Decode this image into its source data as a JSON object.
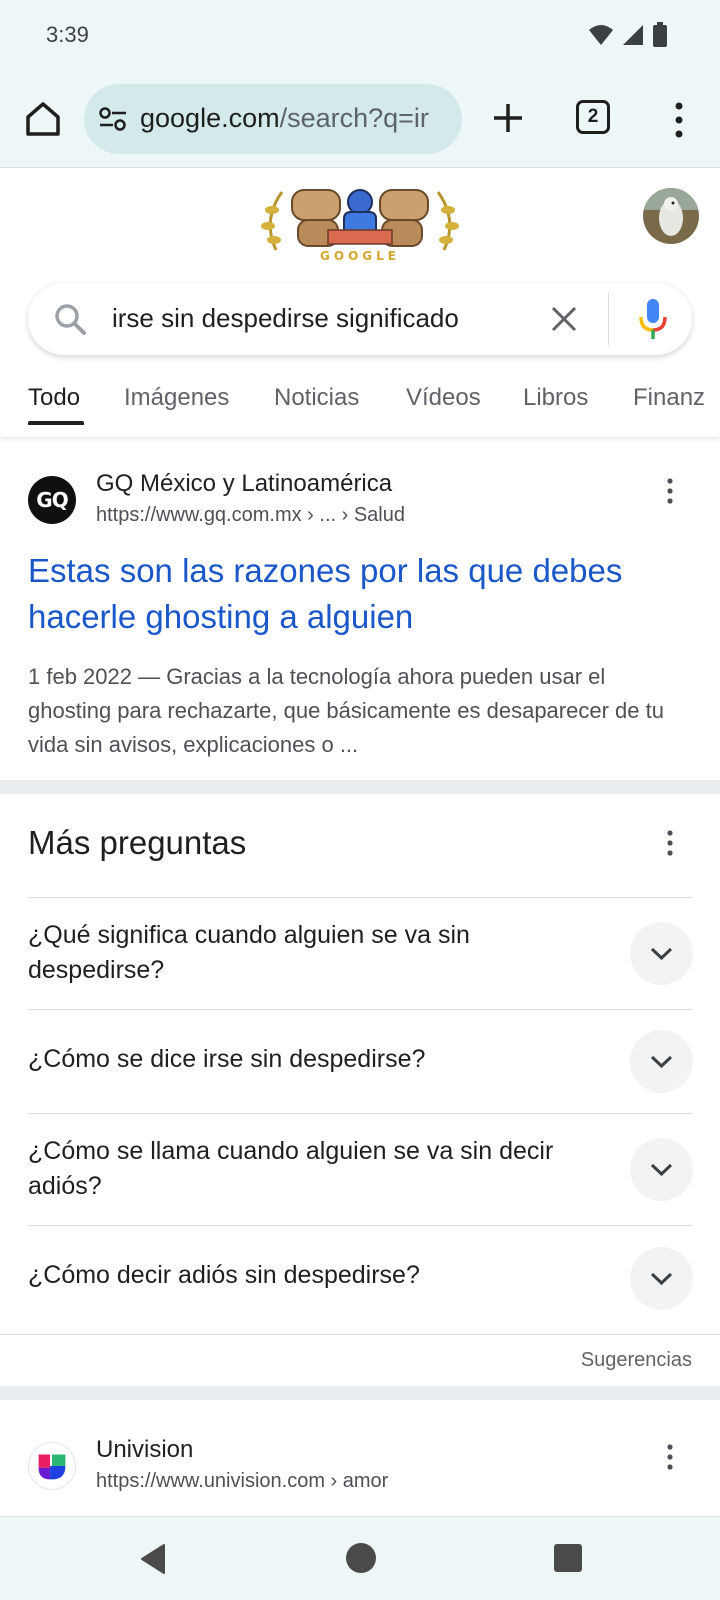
{
  "status_bar": {
    "time": "3:39"
  },
  "browser": {
    "url_host": "google.com",
    "url_rest": "/search?q=ir",
    "tab_count": "2"
  },
  "header": {
    "doodle_text": "GOOGLE"
  },
  "search": {
    "query": "irse sin despedirse significado"
  },
  "tabs": [
    "Todo",
    "Imágenes",
    "Noticias",
    "Vídeos",
    "Libros",
    "Finanz"
  ],
  "result1": {
    "logo_text": "GQ",
    "site_name": "GQ México y Latinoamérica",
    "url": "https://www.gq.com.mx › ... › Salud",
    "title": "Estas son las razones por las que debes hacerle ghosting a alguien",
    "snippet": "1 feb 2022 — Gracias a la tecnología ahora pueden usar el ghosting para rechazarte, que básicamente es desaparecer de tu vida sin avisos, explicaciones o ..."
  },
  "more_questions": {
    "title": "Más preguntas",
    "questions": [
      "¿Qué significa cuando alguien se va sin despedirse?",
      "¿Cómo se dice irse sin despedirse?",
      "¿Cómo se llama cuando alguien se va sin decir adiós?",
      "¿Cómo decir adiós sin despedirse?"
    ],
    "footer": "Sugerencias"
  },
  "result2": {
    "site_name": "Univision",
    "url": "https://www.univision.com › amor"
  },
  "colors": {
    "link": "#1a57c8",
    "chrome_bg": "#eef7f7",
    "urlbar_bg": "#d4e9e9"
  }
}
